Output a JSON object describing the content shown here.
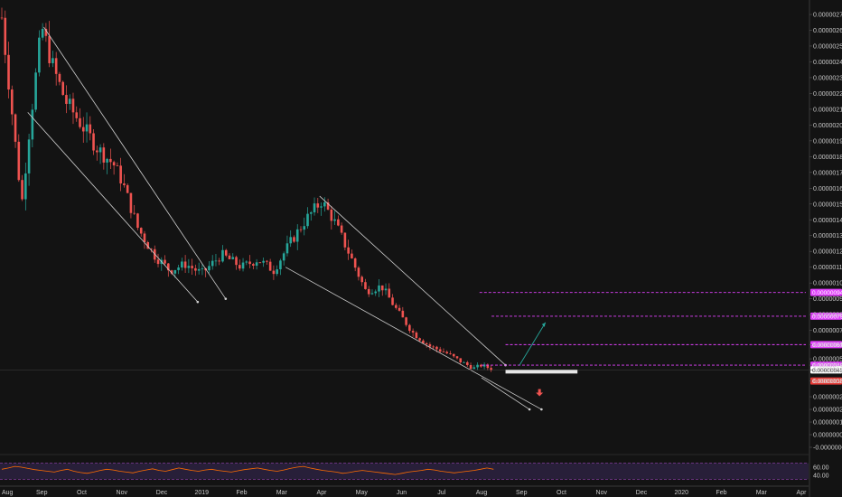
{
  "chart_data": {
    "type": "candlestick",
    "title": "",
    "price_axis": {
      "ticks": [
        "0.00000270",
        "0.00000260",
        "0.00000250",
        "0.00000240",
        "0.00000230",
        "0.00000220",
        "0.00000210",
        "0.00000200",
        "0.00000190",
        "0.00000180",
        "0.00000170",
        "0.00000160",
        "0.00000150",
        "0.00000140",
        "0.00000130",
        "0.00000120",
        "0.00000110",
        "0.00000100",
        "0.00000090",
        "0.00000080",
        "0.00000070",
        "0.00000061",
        "0.00000052",
        "0.00000048",
        "0.00000045",
        "0.00000038",
        "0.00000028",
        "0.00000020",
        "0.00000012",
        "0.00000004",
        "-0.00000004"
      ],
      "range": [
        -8e-08,
        2.75e-06
      ]
    },
    "time_axis": {
      "ticks": [
        "Aug",
        "Sep",
        "Oct",
        "Nov",
        "Dec",
        "2019",
        "Feb",
        "Mar",
        "Apr",
        "May",
        "Jun",
        "Jul",
        "Aug",
        "Sep",
        "Oct",
        "Nov",
        "Dec",
        "2020",
        "Feb",
        "Mar",
        "Apr"
      ]
    },
    "price_path": [
      [
        0.0,
        2.68e-06
      ],
      [
        0.5,
        1.5e-06
      ],
      [
        0.7,
        2e-06
      ],
      [
        1.0,
        2.62e-06
      ],
      [
        1.3,
        2.35e-06
      ],
      [
        1.6,
        2.15e-06
      ],
      [
        2.0,
        2e-06
      ],
      [
        2.4,
        1.85e-06
      ],
      [
        2.8,
        1.75e-06
      ],
      [
        3.0,
        1.65e-06
      ],
      [
        3.4,
        1.35e-06
      ],
      [
        3.8,
        1.18e-06
      ],
      [
        4.2,
        1.08e-06
      ],
      [
        4.6,
        1.12e-06
      ],
      [
        5.0,
        1.06e-06
      ],
      [
        5.5,
        1.18e-06
      ],
      [
        6.0,
        1.1e-06
      ],
      [
        6.4,
        1.15e-06
      ],
      [
        6.8,
        1.08e-06
      ],
      [
        7.2,
        1.25e-06
      ],
      [
        7.6,
        1.4e-06
      ],
      [
        8.0,
        1.52e-06
      ],
      [
        8.3,
        1.4e-06
      ],
      [
        8.7,
        1.18e-06
      ],
      [
        9.1,
        9.5e-07
      ],
      [
        9.5,
        9.8e-07
      ],
      [
        9.9,
        8.2e-07
      ],
      [
        10.3,
        6.8e-07
      ],
      [
        10.7,
        6e-07
      ],
      [
        11.1,
        5.6e-07
      ],
      [
        11.5,
        5e-07
      ],
      [
        11.8,
        4.6e-07
      ],
      [
        12.0,
        4.8e-07
      ],
      [
        12.3,
        4.5e-07
      ]
    ],
    "horizontal_levels": [
      {
        "value": "0.00000094",
        "color": "#e040fb"
      },
      {
        "value": "0.00000079",
        "color": "#e040fb"
      },
      {
        "value": "0.00000061",
        "color": "#e040fb"
      },
      {
        "value": "0.00000048",
        "color": "#e040fb"
      }
    ],
    "current_price": {
      "value": "0.00000045",
      "color": "#ffffff"
    },
    "support_price": {
      "value": "0.00000038",
      "color": "#e53935"
    },
    "rsi": {
      "ticks": [
        "60.00",
        "40.00"
      ],
      "range": [
        20,
        80
      ],
      "bands": [
        70,
        30
      ],
      "values": [
        55,
        58,
        62,
        60,
        57,
        54,
        52,
        50,
        48,
        52,
        55,
        50,
        47,
        45,
        48,
        52,
        55,
        53,
        50,
        48,
        46,
        50,
        53,
        56,
        52,
        50,
        54,
        58,
        55,
        52,
        50,
        53,
        55,
        52,
        50,
        48,
        51,
        54,
        56,
        58,
        55,
        52,
        50,
        53,
        57,
        60,
        62,
        58,
        55,
        52,
        50,
        48,
        45,
        47,
        50,
        52,
        50,
        48,
        46,
        44,
        42,
        45,
        48,
        50,
        52,
        55,
        53,
        50,
        48,
        46,
        48,
        50,
        52,
        55,
        58,
        55
      ]
    },
    "colors": {
      "up": "#26a69a",
      "down": "#ef5350",
      "trendline": "#d0d0d0",
      "rsi_line": "#ff6d00",
      "rsi_band": "#3a2a5a",
      "bullish_arrow": "#26a69a",
      "bearish_arrow": "#ef5350"
    }
  }
}
